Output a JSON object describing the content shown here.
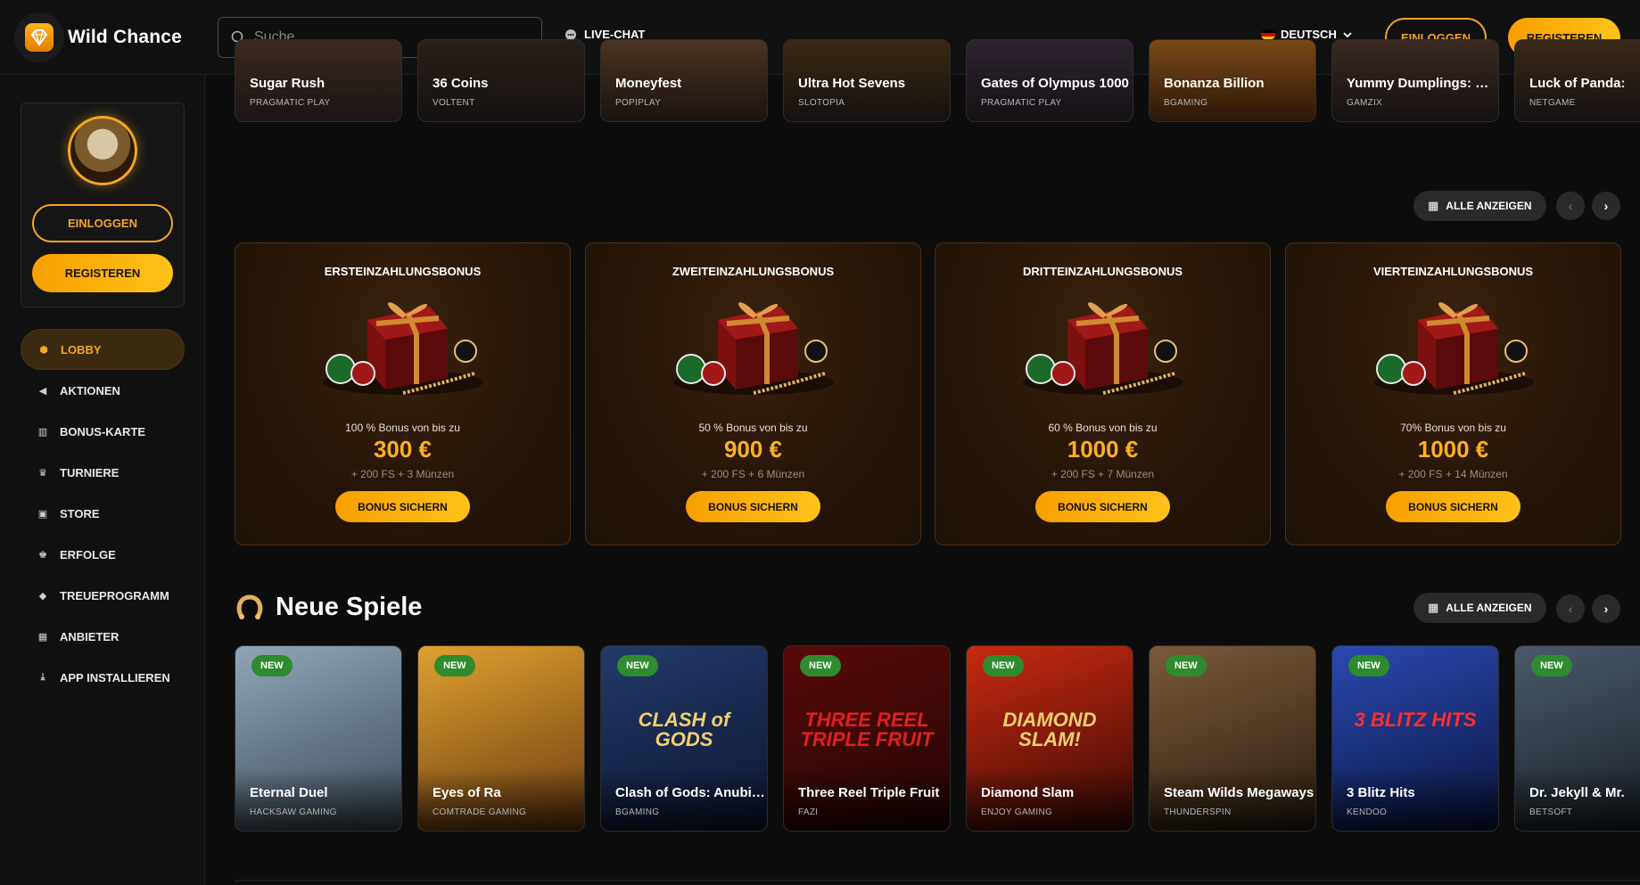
{
  "header": {
    "logo_text": "Wild Chance",
    "search_placeholder": "Suche",
    "live_chat": "LIVE-CHAT",
    "language": "DEUTSCH",
    "login": "EINLOGGEN",
    "register": "REGISTEREN"
  },
  "sidebar": {
    "login": "EINLOGGEN",
    "register": "REGISTEREN",
    "items": [
      {
        "label": "LOBBY",
        "icon": "cube-icon"
      },
      {
        "label": "AKTIONEN",
        "icon": "megaphone-icon"
      },
      {
        "label": "BONUS-KARTE",
        "icon": "map-icon"
      },
      {
        "label": "TURNIERE",
        "icon": "trophy-icon"
      },
      {
        "label": "STORE",
        "icon": "store-icon"
      },
      {
        "label": "ERFOLGE",
        "icon": "crown-icon"
      },
      {
        "label": "TREUEPROGRAMM",
        "icon": "diamond-icon"
      },
      {
        "label": "ANBIETER",
        "icon": "grid-icon"
      },
      {
        "label": "APP INSTALLIEREN",
        "icon": "download-icon"
      }
    ]
  },
  "top_games": [
    {
      "title": "Sugar Rush",
      "provider": "PRAGMATIC PLAY"
    },
    {
      "title": "36 Coins",
      "provider": "VOLTENT"
    },
    {
      "title": "Moneyfest",
      "provider": "POPIPLAY"
    },
    {
      "title": "Ultra Hot Sevens",
      "provider": "SLOTOPIA"
    },
    {
      "title": "Gates of Olympus 1000",
      "provider": "PRAGMATIC PLAY"
    },
    {
      "title": "Bonanza Billion",
      "provider": "BGAMING"
    },
    {
      "title": "Yummy Dumplings: Ho...",
      "provider": "GAMZIX"
    },
    {
      "title": "Luck of Panda:",
      "provider": "NETGAME"
    }
  ],
  "bonus_section": {
    "show_all": "ALLE ANZEIGEN",
    "cards": [
      {
        "title": "ERSTEINZAHLUNGSBONUS",
        "desc": "100 % Bonus von bis zu",
        "amount": "300 €",
        "extra": "+ 200 FS + 3 Münzen",
        "button": "BONUS SICHERN"
      },
      {
        "title": "ZWEITEINZAHLUNGSBONUS",
        "desc": "50 % Bonus von bis zu",
        "amount": "900 €",
        "extra": "+ 200 FS + 6 Münzen",
        "button": "BONUS SICHERN"
      },
      {
        "title": "DRITTEINZAHLUNGSBONUS",
        "desc": "60 % Bonus von bis zu",
        "amount": "1000 €",
        "extra": "+ 200 FS + 7 Münzen",
        "button": "BONUS SICHERN"
      },
      {
        "title": "VIERTEINZAHLUNGSBONUS",
        "desc": "70% Bonus von bis zu",
        "amount": "1000 €",
        "extra": "+ 200 FS + 14 Münzen",
        "button": "BONUS SICHERN"
      }
    ]
  },
  "new_games": {
    "title": "Neue Spiele",
    "show_all": "ALLE ANZEIGEN",
    "badge": "NEW",
    "games": [
      {
        "title": "Eternal Duel",
        "provider": "HACKSAW GAMING",
        "art": "",
        "colors": [
          "#8fa6b8",
          "#3d4a58"
        ]
      },
      {
        "title": "Eyes of Ra",
        "provider": "COMTRADE GAMING",
        "art": "",
        "colors": [
          "#e0a030",
          "#6a3a10"
        ]
      },
      {
        "title": "Clash of Gods: Anubis ...",
        "provider": "BGAMING",
        "art": "CLASH of GODS",
        "colors": [
          "#223a6a",
          "#0e1630"
        ]
      },
      {
        "title": "Three Reel Triple Fruit",
        "provider": "FAZI",
        "art": "THREE REEL TRIPLE FRUIT",
        "colors": [
          "#5a0a0a",
          "#200404"
        ]
      },
      {
        "title": "Diamond Slam",
        "provider": "ENJOY GAMING",
        "art": "DIAMOND SLAM!",
        "colors": [
          "#c82a10",
          "#3a0a04"
        ]
      },
      {
        "title": "Steam Wilds Megaways",
        "provider": "THUNDERSPIN",
        "art": "",
        "colors": [
          "#7a5a3a",
          "#2a1c10"
        ]
      },
      {
        "title": "3 Blitz Hits",
        "provider": "KENDOO",
        "art": "3 BLITZ HITS",
        "colors": [
          "#2a4ab0",
          "#0a1440"
        ]
      },
      {
        "title": "Dr. Jekyll & Mr.",
        "provider": "BETSOFT",
        "art": "",
        "colors": [
          "#4a5a6a",
          "#1a2028"
        ]
      }
    ]
  },
  "colors": {
    "accent": "#f5a623",
    "bg": "#0c0c0c",
    "new_badge": "#2e8b2e"
  }
}
